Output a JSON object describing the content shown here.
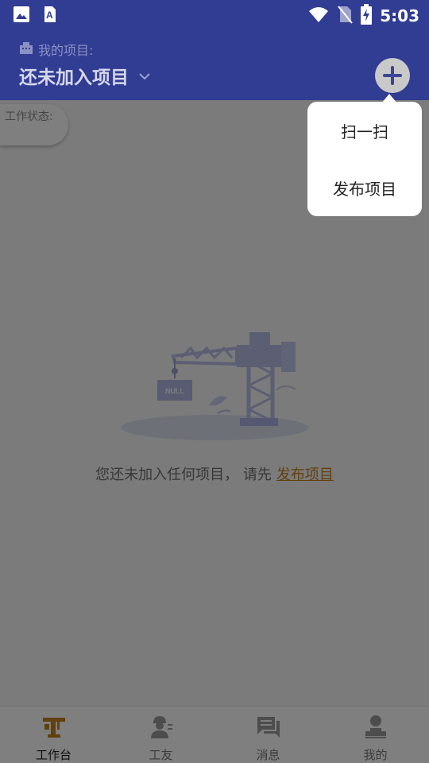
{
  "status_bar": {
    "time": "5:03",
    "icons": [
      "image-icon",
      "text-a-icon",
      "wifi-icon",
      "no-sim-icon",
      "battery-charging-icon"
    ]
  },
  "header": {
    "subtitle": "我的项目:",
    "title": "还未加入项目",
    "icons": [
      "building-icon",
      "chevron-down-icon",
      "add-icon"
    ]
  },
  "work_status": {
    "label": "工作状态:"
  },
  "empty_state": {
    "illustration_label": "NULL",
    "message": "您还未加入任何项目， 请先",
    "link": "发布项目"
  },
  "popup_menu": {
    "items": [
      "扫一扫",
      "发布项目"
    ]
  },
  "tabbar": {
    "active": "工作台",
    "tabs": [
      {
        "label": "工作台",
        "icon": "crane-icon"
      },
      {
        "label": "工友",
        "icon": "worker-icon"
      },
      {
        "label": "消息",
        "icon": "chat-icon"
      },
      {
        "label": "我的",
        "icon": "stamp-person-icon"
      }
    ]
  },
  "colors": {
    "primary": "#313c93",
    "accent": "#c4811a",
    "overlay": "#7b7b7b"
  }
}
